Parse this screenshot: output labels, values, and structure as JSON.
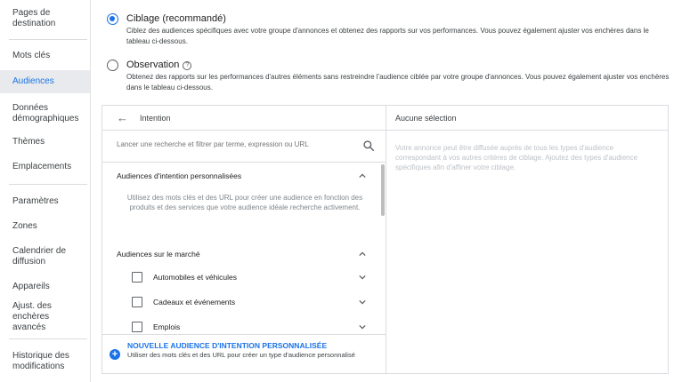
{
  "sidebar": {
    "items": [
      {
        "label": "Pages de destination"
      },
      {
        "label": "Mots clés"
      },
      {
        "label": "Audiences"
      },
      {
        "label": "Données démographiques"
      },
      {
        "label": "Thèmes"
      },
      {
        "label": "Emplacements"
      },
      {
        "label": "Paramètres"
      },
      {
        "label": "Zones"
      },
      {
        "label": "Calendrier de diffusion"
      },
      {
        "label": "Appareils"
      },
      {
        "label": "Ajust. des enchères avancés"
      },
      {
        "label": "Historique des modifications"
      }
    ],
    "active_index": 2
  },
  "targeting": {
    "option1": {
      "title": "Ciblage (recommandé)",
      "desc": "Ciblez des audiences spécifiques avec votre groupe d'annonces et obtenez des rapports sur vos performances. Vous pouvez également ajuster vos enchères dans le tableau ci-dessous.",
      "selected": true
    },
    "option2": {
      "title": "Observation",
      "help": "?",
      "desc": "Obtenez des rapports sur les performances d'autres éléments sans restreindre l'audience ciblée par votre groupe d'annonces. Vous pouvez également ajuster vos enchères dans le tableau ci-dessous.",
      "selected": false
    }
  },
  "left_panel": {
    "back_arrow": "←",
    "title": "Intention",
    "search_placeholder": "Lancer une recherche et filtrer par terme, expression ou URL",
    "section1": {
      "title": "Audiences d'intention personnalisées",
      "desc": "Utilisez des mots clés et des URL pour créer une audience en fonction des produits et des services que votre audience idéale recherche activement."
    },
    "section2": {
      "title": "Audiences sur le marché",
      "items": [
        {
          "label": "Automobiles et véhicules"
        },
        {
          "label": "Cadeaux et événements"
        },
        {
          "label": "Emplois"
        }
      ]
    },
    "footer": {
      "plus": "+",
      "title": "NOUVELLE AUDIENCE D'INTENTION PERSONNALISÉE",
      "desc": "Utiliser des mots clés et des URL pour créer un type d'audience personnalisé"
    }
  },
  "right_panel": {
    "title": "Aucune sélection",
    "body": "Votre annonce peut être diffusée auprès de tous les types d'audience correspondant à vos autres critères de ciblage. Ajoutez des types d'audience spécifiques afin d'affiner votre ciblage."
  },
  "colors": {
    "accent": "#1a73e8",
    "active_bg": "#e8eaed",
    "border": "#dadce0"
  },
  "icons": {
    "search": "search-icon",
    "back": "arrow-left-icon",
    "expand": "chevron-down-icon",
    "collapse": "chevron-up-icon",
    "add": "plus-circle-icon",
    "help": "help-circle-icon"
  }
}
